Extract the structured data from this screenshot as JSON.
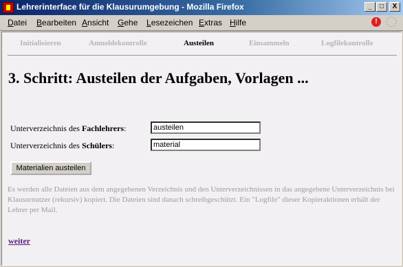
{
  "window": {
    "title": "Lehrerinterface für die Klausurumgebung - Mozilla Firefox",
    "controls": [
      "_",
      "□",
      "X"
    ]
  },
  "menu": [
    "Datei",
    "Bearbeiten",
    "Ansicht",
    "Gehe",
    "Lesezeichen",
    "Extras",
    "Hilfe"
  ],
  "steps": [
    {
      "label": "Initialisieren",
      "active": false
    },
    {
      "label": "Anmeldekontrolle",
      "active": false
    },
    {
      "label": "Austeilen",
      "active": true
    },
    {
      "label": "Einsammeln",
      "active": false
    },
    {
      "label": "Logfilekontrolle",
      "active": false
    }
  ],
  "heading": "3. Schritt: Austeilen der Aufgaben, Vorlagen ...",
  "form": {
    "teacher_label_pre": "Unterverzeichnis des ",
    "teacher_label_bold": "Fachlehrers",
    "teacher_label_post": ":",
    "teacher_value": "austeilen",
    "student_label_pre": "Unterverzeichnis des ",
    "student_label_bold": "Schülers",
    "student_label_post": ":",
    "student_value": "material",
    "button": "Materialien austeilen"
  },
  "description": "Es werden alle Dateien aus dem angegebenen Verzeichnis und den Unterverzeichnissen in das angegebene Unterverzeichnis bei Klausurnutzer (rekursiv) kopiert. Die Dateien sind danach schreibgeschützt. Ein \"Logfile\" dieser Kopieraktionen erhält der Lehrer per Mail.",
  "next_link": "weiter"
}
